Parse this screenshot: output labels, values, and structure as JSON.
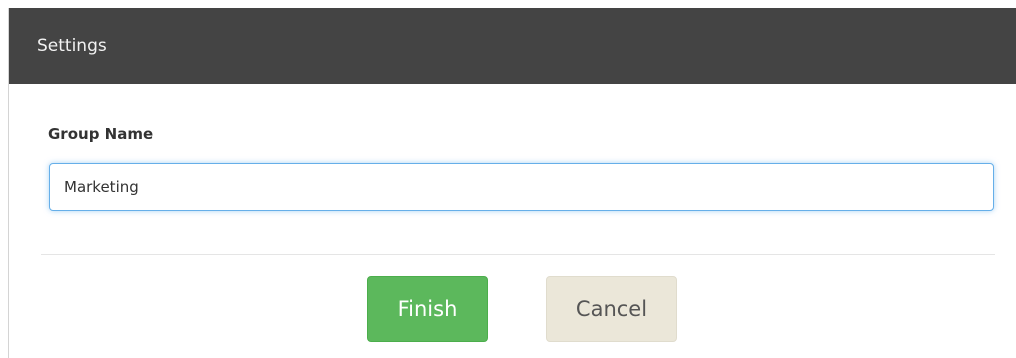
{
  "dialog": {
    "title": "Settings"
  },
  "form": {
    "group_name_label": "Group Name",
    "group_name_value": "Marketing"
  },
  "actions": {
    "finish_label": "Finish",
    "cancel_label": "Cancel"
  },
  "colors": {
    "header_bg": "#444444",
    "finish_bg": "#5cb85c",
    "cancel_bg": "#ebe7d9",
    "input_focus_border": "#66afe9"
  }
}
